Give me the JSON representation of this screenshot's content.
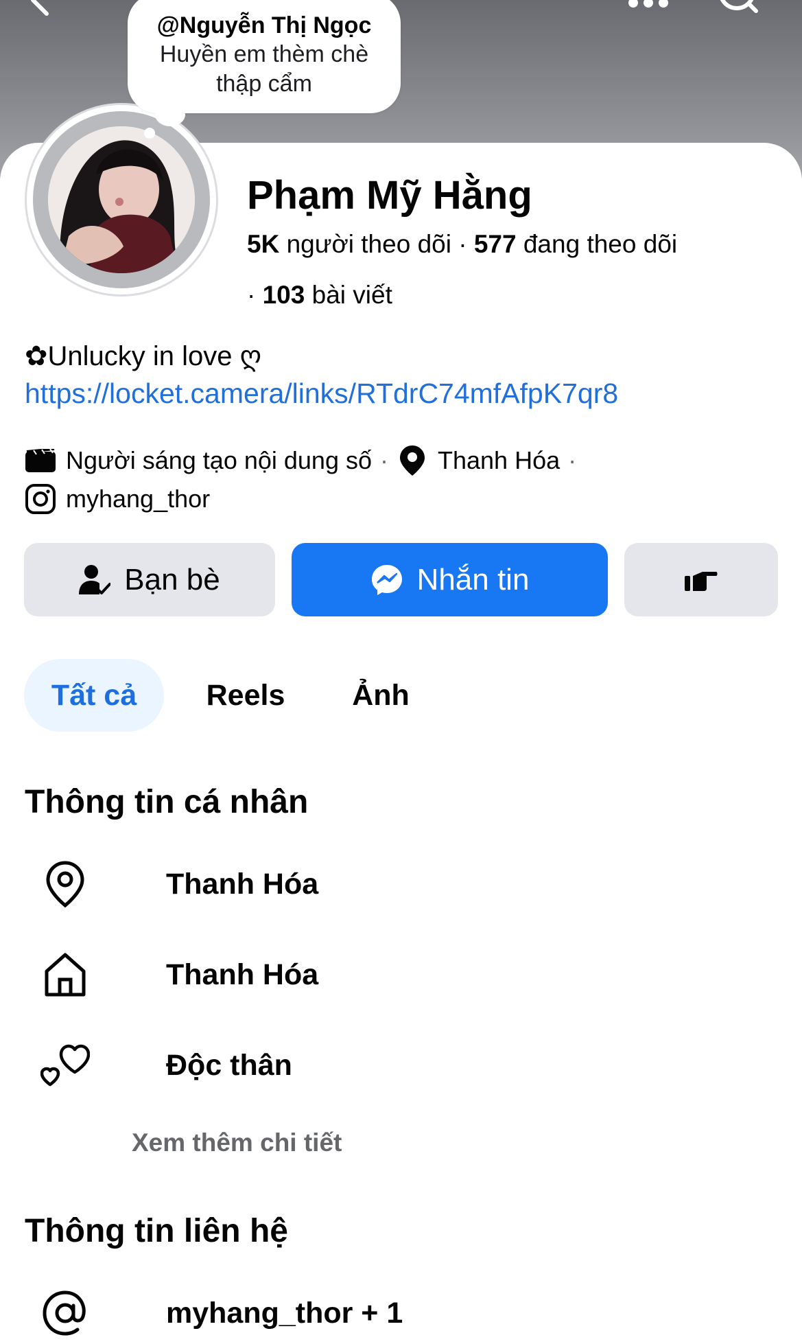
{
  "note": {
    "author": "@Nguyễn Thị Ngọc",
    "text_line1": "Huyền em thèm chè",
    "text_line2": "thập cẩm"
  },
  "profile": {
    "name": "Phạm Mỹ Hằng",
    "followers_count": "5K",
    "followers_label": "người theo dõi",
    "following_count": "577",
    "following_label": "đang theo dõi",
    "posts_count": "103",
    "posts_label": "bài viết",
    "bio_text": "✿Unlucky in love ღ",
    "bio_link": "https://locket.camera/links/RTdrC74mfAfpK7qr8",
    "category": "Người sáng tạo nội dung số",
    "location": "Thanh Hóa",
    "instagram": "myhang_thor"
  },
  "actions": {
    "friends_label": "Bạn bè",
    "message_label": "Nhắn tin"
  },
  "tabs": [
    {
      "label": "Tất cả",
      "active": true
    },
    {
      "label": "Reels",
      "active": false
    },
    {
      "label": "Ảnh",
      "active": false
    }
  ],
  "personal_info": {
    "title": "Thông tin cá nhân",
    "lives_in": "Thanh Hóa",
    "hometown": "Thanh Hóa",
    "relationship": "Độc thân",
    "see_more": "Xem thêm chi tiết"
  },
  "contact_info": {
    "title": "Thông tin liên hệ",
    "accounts": "myhang_thor + 1"
  },
  "colors": {
    "accent": "#1877f2",
    "link": "#216fdb",
    "tab_active_bg": "#ebf5ff",
    "button_gray": "#e4e6eb"
  },
  "icons": {
    "back": "chevron-left-icon",
    "more": "more-dots-icon",
    "search": "search-icon",
    "category": "clapperboard-icon",
    "location": "location-pin-icon",
    "instagram": "instagram-icon",
    "friends": "person-check-icon",
    "messenger": "messenger-icon",
    "poke": "poke-hand-icon",
    "home": "home-icon",
    "relationship": "hearts-icon",
    "contact": "at-sign-icon"
  }
}
